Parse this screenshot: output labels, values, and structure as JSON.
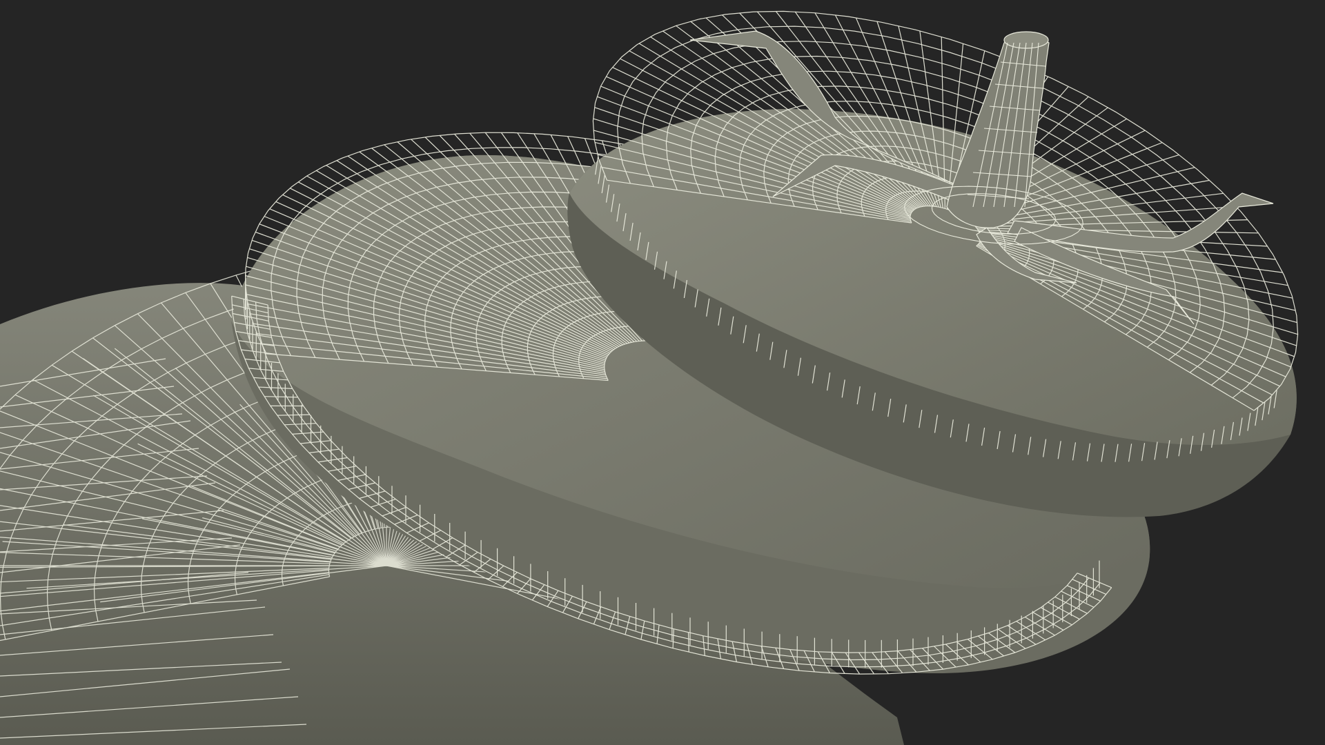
{
  "scene": {
    "subject": "tomato-slices-wireframe",
    "background_color": "#252525",
    "mesh_fill": "#7a7b6d",
    "mesh_fill_shadow": "#5f6055",
    "wire_color": "#e9eadc",
    "pieces": [
      "lower-slice",
      "middle-slice",
      "top-cap",
      "stem-calyx"
    ]
  }
}
